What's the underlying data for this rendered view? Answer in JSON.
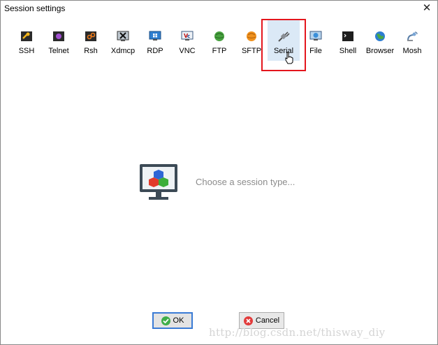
{
  "window": {
    "title": "Session settings",
    "close_glyph": "✕"
  },
  "session_types": [
    {
      "label": "SSH",
      "icon": "ssh-key-icon"
    },
    {
      "label": "Telnet",
      "icon": "telnet-icon"
    },
    {
      "label": "Rsh",
      "icon": "rsh-icon"
    },
    {
      "label": "Xdmcp",
      "icon": "xdmcp-icon"
    },
    {
      "label": "RDP",
      "icon": "rdp-icon"
    },
    {
      "label": "VNC",
      "icon": "vnc-icon"
    },
    {
      "label": "FTP",
      "icon": "ftp-icon"
    },
    {
      "label": "SFTP",
      "icon": "sftp-icon"
    },
    {
      "label": "Serial",
      "icon": "serial-plug-icon"
    },
    {
      "label": "File",
      "icon": "file-monitor-icon"
    },
    {
      "label": "Shell",
      "icon": "shell-terminal-icon"
    },
    {
      "label": "Browser",
      "icon": "browser-globe-icon"
    },
    {
      "label": "Mosh",
      "icon": "mosh-satellite-icon"
    }
  ],
  "selected_type": "Serial",
  "placeholder": {
    "text": "Choose a session type..."
  },
  "buttons": {
    "ok_label": "OK",
    "cancel_label": "Cancel"
  },
  "watermark": "http://blog.csdn.net/thisway_diy",
  "colors": {
    "highlight": "#e4161d",
    "selected_bg": "#dbe9f6",
    "ok_green": "#3fae49",
    "cancel_red": "#e23b3b"
  }
}
